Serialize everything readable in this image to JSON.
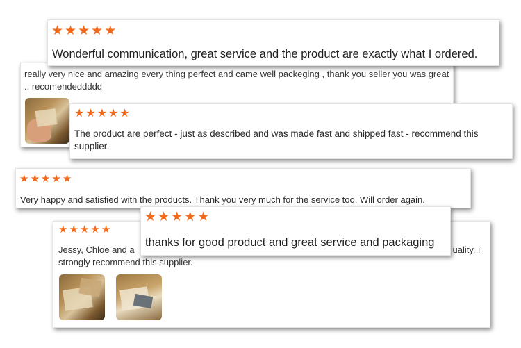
{
  "reviews": [
    {
      "id": "r1",
      "rating": 5,
      "text": "Wonderful communication, great service and the product are exactly what I ordered."
    },
    {
      "id": "r2",
      "rating": 5,
      "text": "really very nice and amazing every thing perfect and came well packeging , thank you seller you was great .. recomendeddddd",
      "photos": [
        "review-photo-soap-in-hand"
      ]
    },
    {
      "id": "r3",
      "rating": 5,
      "text": "The product are perfect - just as described and was made fast and shipped fast - recommend this supplier."
    },
    {
      "id": "r4",
      "rating": 5,
      "text": "Very happy and satisfied with the products. Thank you very much for the service too. Will order again."
    },
    {
      "id": "r5",
      "rating": 5,
      "text_start": "Jessy, Chloe and a",
      "text_end": "uality. i",
      "text_line2": "strongly recommend this supplier.",
      "photos": [
        "review-photo-boxes",
        "review-photo-open-box"
      ]
    },
    {
      "id": "r6",
      "rating": 5,
      "text": "thanks for good product and great service and packaging"
    }
  ],
  "star_glyph": "★",
  "star_color": "#f26a1b"
}
